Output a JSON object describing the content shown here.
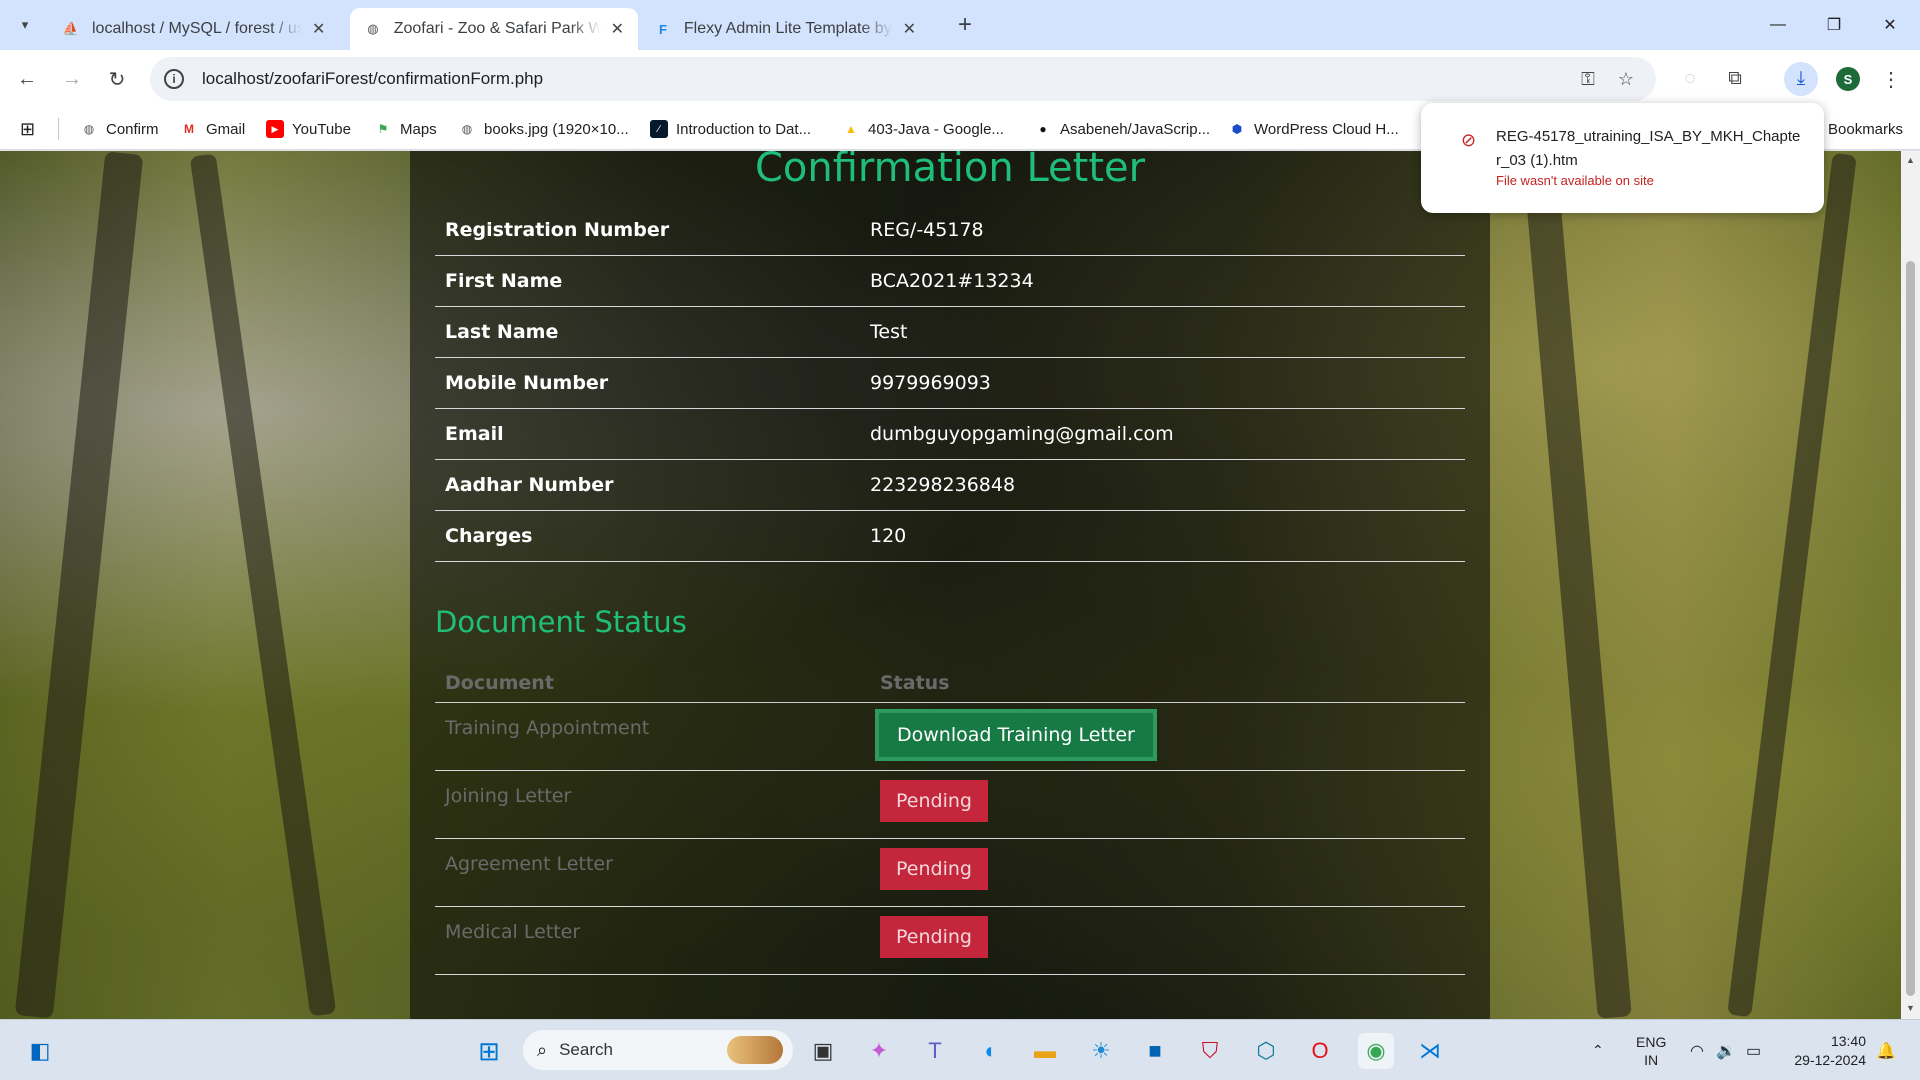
{
  "browser": {
    "tabs": [
      {
        "title": "localhost / MySQL / forest / use",
        "favicon": "phpmyadmin-icon",
        "active": false
      },
      {
        "title": "Zoofari - Zoo & Safari Park Web",
        "favicon": "globe-icon",
        "active": true
      },
      {
        "title": "Flexy Admin Lite Template by W",
        "favicon": "flexy-icon",
        "active": false
      }
    ],
    "url": "localhost/zoofariForest/confirmationForm.php"
  },
  "bookmarks": [
    {
      "label": "Confirm",
      "icon": "globe-icon"
    },
    {
      "label": "Gmail",
      "icon": "gmail-icon"
    },
    {
      "label": "YouTube",
      "icon": "youtube-icon"
    },
    {
      "label": "Maps",
      "icon": "maps-icon"
    },
    {
      "label": "books.jpg (1920×10...",
      "icon": "globe-icon"
    },
    {
      "label": "Introduction to Dat...",
      "icon": "datacamp-icon"
    },
    {
      "label": "403-Java - Google...",
      "icon": "drive-icon"
    },
    {
      "label": "Asabeneh/JavaScrip...",
      "icon": "github-icon"
    },
    {
      "label": "WordPress Cloud H...",
      "icon": "wordpress-icon"
    }
  ],
  "bookmarks_folder": "Bookmarks",
  "download": {
    "filename": "REG-45178_utraining_ISA_BY_MKH_Chapter_03 (1).htm",
    "status": "File wasn't available on site"
  },
  "page": {
    "title": "Confirmation Letter",
    "fields": [
      {
        "label": "Registration Number",
        "value": "REG/-45178"
      },
      {
        "label": "First Name",
        "value": "BCA2021#13234"
      },
      {
        "label": "Last Name",
        "value": "Test"
      },
      {
        "label": "Mobile Number",
        "value": "9979969093"
      },
      {
        "label": "Email",
        "value": "dumbguyopgaming@gmail.com"
      },
      {
        "label": "Aadhar Number",
        "value": "223298236848"
      },
      {
        "label": "Charges",
        "value": "120"
      }
    ],
    "doc_status_title": "Document Status",
    "doc_headers": {
      "document": "Document",
      "status": "Status"
    },
    "documents": [
      {
        "name": "Training Appointment",
        "action": "Download Training Letter",
        "kind": "download"
      },
      {
        "name": "Joining Letter",
        "action": "Pending",
        "kind": "pending"
      },
      {
        "name": "Agreement Letter",
        "action": "Pending",
        "kind": "pending"
      },
      {
        "name": "Medical Letter",
        "action": "Pending",
        "kind": "pending"
      }
    ],
    "accent_color": "#1fbf7a",
    "download_button_color": "#177a45",
    "pending_color": "#c4263b"
  },
  "taskbar": {
    "search_placeholder": "Search",
    "language": "ENG",
    "region": "IN",
    "time": "13:40",
    "date": "29-12-2024"
  },
  "profile_initial": "S"
}
